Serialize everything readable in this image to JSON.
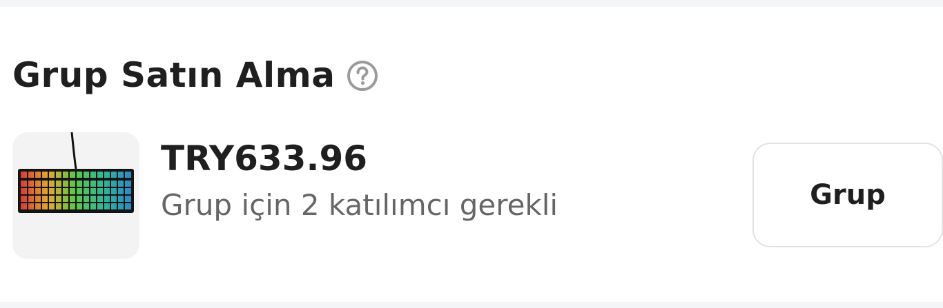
{
  "section": {
    "title": "Grup Satın Alma",
    "help_icon": "question-circle-icon"
  },
  "product": {
    "image": "keyboard-product-image",
    "price": "TRY633.96",
    "participants_text": "Grup için 2 katılımcı gerekli"
  },
  "actions": {
    "group_button_label": "Grup"
  },
  "colors": {
    "text_primary": "#1f1f1f",
    "text_secondary": "#666666",
    "icon_gray": "#9a9a9a",
    "border": "#e2e2e2",
    "background_strip": "#f4f5f7"
  }
}
